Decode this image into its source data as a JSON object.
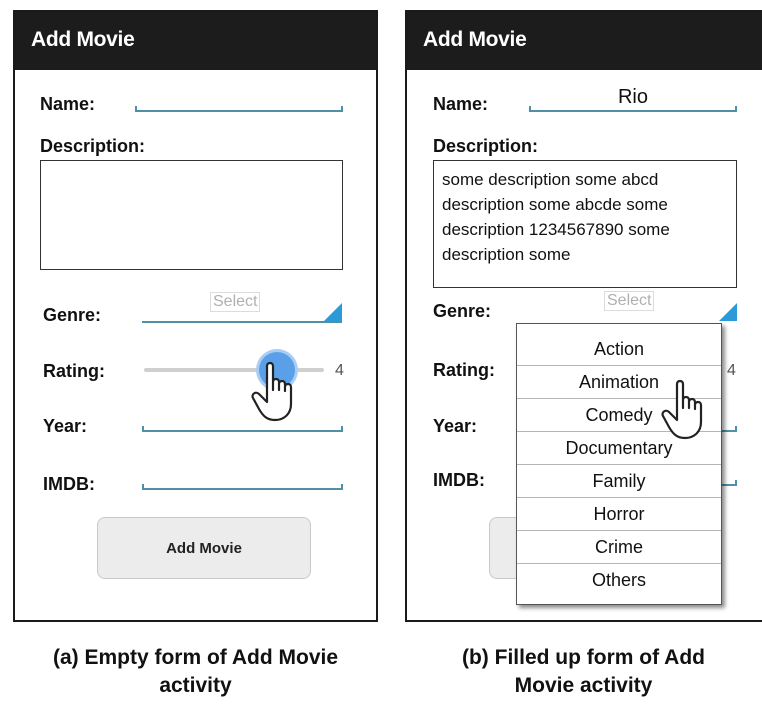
{
  "screen_a": {
    "title": "Add Movie",
    "name_label": "Name:",
    "description_label": "Description:",
    "genre_label": "Genre:",
    "genre_placeholder": "Select",
    "rating_label": "Rating:",
    "rating_value": "4",
    "rating_fraction": 0.8,
    "year_label": "Year:",
    "imdb_label": "IMDB:",
    "add_button_label": "Add Movie"
  },
  "screen_b": {
    "title": "Add Movie",
    "name_label": "Name:",
    "name_value": "Rio",
    "description_label": "Description:",
    "description_lines": [
      "some description some abcd",
      "description some abcde some",
      "description 1234567890 some",
      "description some"
    ],
    "genre_label": "Genre:",
    "genre_placeholder": "Select",
    "rating_label": "Rating:",
    "rating_value": "4",
    "year_label": "Year:",
    "imdb_label": "IMDB:",
    "genre_options": [
      "Action",
      "Animation",
      "Comedy",
      "Documentary",
      "Family",
      "Horror",
      "Crime",
      "Others"
    ]
  },
  "captions": {
    "a_line1": "(a) Empty form of Add Movie",
    "a_line2": "activity",
    "b_line1": "(b) Filled up form of Add",
    "b_line2": "Movie activity"
  },
  "colors": {
    "title_bar": "#1c1c1c",
    "underline": "#4f8fa8",
    "select_triangle": "#2b9ad6",
    "slider_thumb": "#5aa0e8"
  },
  "icons": {
    "pointer": "hand-pointer-icon",
    "dropdown": "dropdown-triangle-icon"
  }
}
